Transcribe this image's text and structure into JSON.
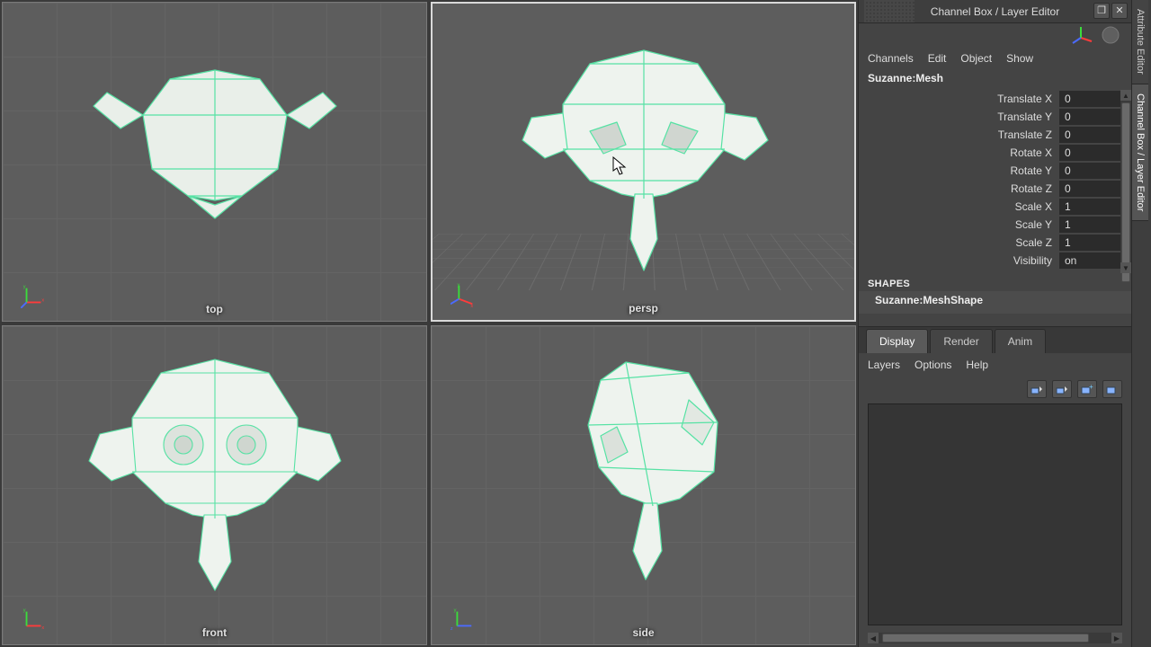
{
  "panel": {
    "title": "Channel Box / Layer Editor",
    "sideTabs": {
      "attr": "Attribute Editor",
      "chan": "Channel Box / Layer Editor"
    }
  },
  "viewports": {
    "top": "top",
    "persp": "persp",
    "front": "front",
    "side": "side"
  },
  "channelMenu": {
    "channels": "Channels",
    "edit": "Edit",
    "object": "Object",
    "show": "Show"
  },
  "objectName": "Suzanne:Mesh",
  "channels": [
    {
      "label": "Translate X",
      "value": "0"
    },
    {
      "label": "Translate Y",
      "value": "0"
    },
    {
      "label": "Translate Z",
      "value": "0"
    },
    {
      "label": "Rotate X",
      "value": "0"
    },
    {
      "label": "Rotate Y",
      "value": "0"
    },
    {
      "label": "Rotate Z",
      "value": "0"
    },
    {
      "label": "Scale X",
      "value": "1"
    },
    {
      "label": "Scale Y",
      "value": "1"
    },
    {
      "label": "Scale Z",
      "value": "1"
    },
    {
      "label": "Visibility",
      "value": "on"
    }
  ],
  "shapesHeader": "SHAPES",
  "shapeName": "Suzanne:MeshShape",
  "layerTabs": {
    "display": "Display",
    "render": "Render",
    "anim": "Anim"
  },
  "layerMenu": {
    "layers": "Layers",
    "options": "Options",
    "help": "Help"
  },
  "colors": {
    "wire": "#56e2a4",
    "face": "#e9efe9"
  }
}
